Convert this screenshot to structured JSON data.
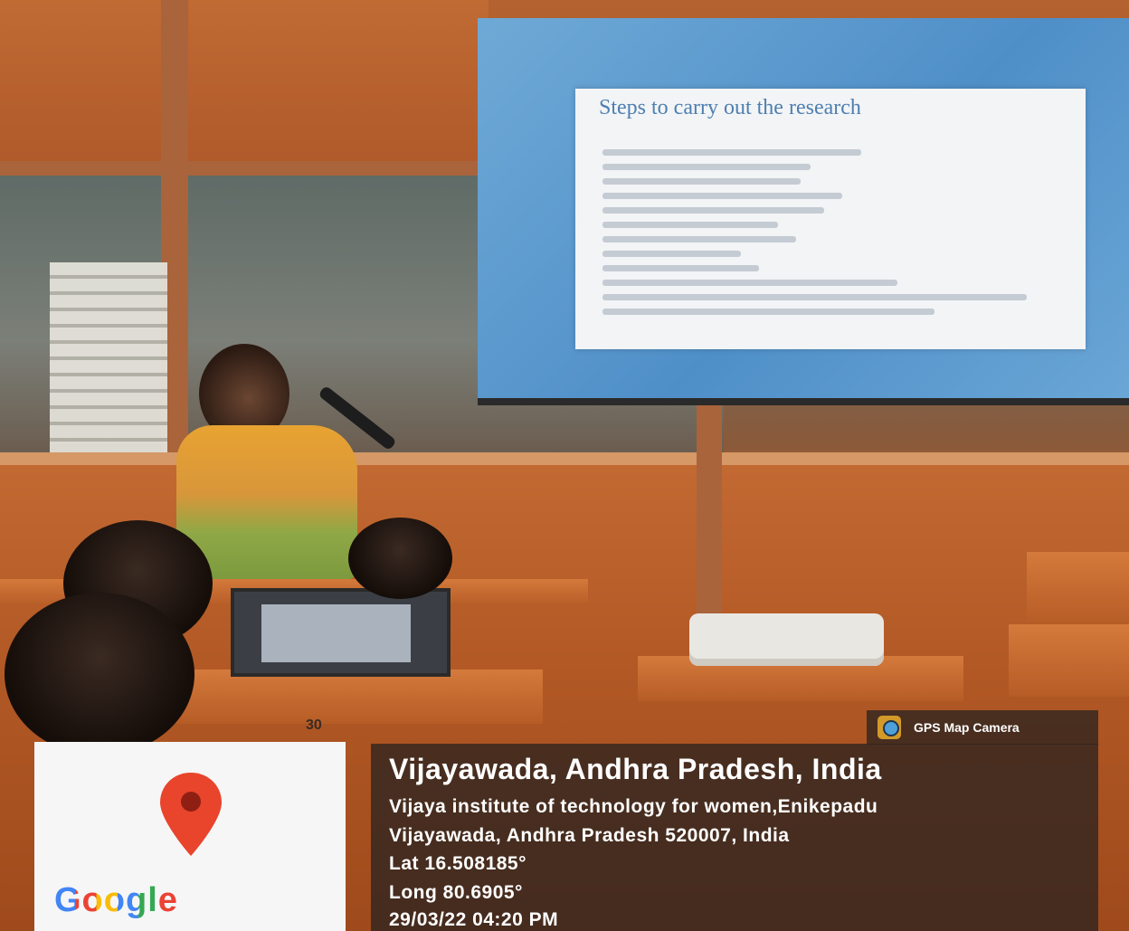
{
  "slide": {
    "title": "Steps to carry out the research"
  },
  "room": {
    "socket_label": "30"
  },
  "overlay": {
    "camera_app": "GPS Map Camera",
    "map_brand": "Google",
    "location_title": "Vijayawada, Andhra Pradesh, India",
    "address_line1": "Vijaya institute of technology for women,Enikepadu",
    "address_line2": "Vijayawada, Andhra Pradesh 520007, India",
    "latitude": "Lat 16.508185°",
    "longitude": "Long 80.6905°",
    "timestamp": "29/03/22 04:20 PM",
    "pin_color": "#e8452c"
  }
}
